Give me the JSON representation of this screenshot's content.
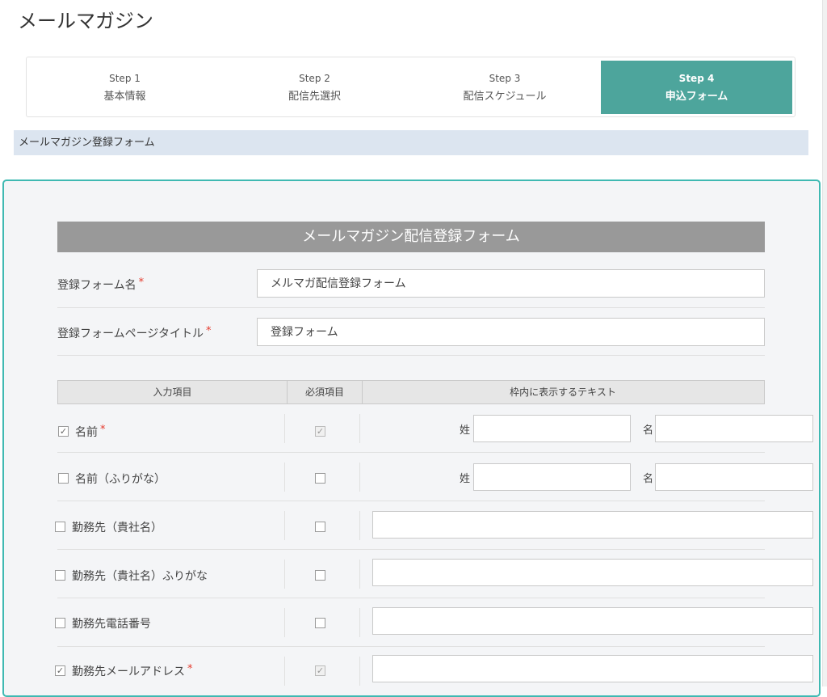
{
  "page": {
    "title": "メールマガジン"
  },
  "steps": [
    {
      "num": "Step 1",
      "label": "基本情報",
      "active": false
    },
    {
      "num": "Step 2",
      "label": "配信先選択",
      "active": false
    },
    {
      "num": "Step 3",
      "label": "配信スケジュール",
      "active": false
    },
    {
      "num": "Step 4",
      "label": "申込フォーム",
      "active": true
    }
  ],
  "section": {
    "title": "メールマガジン登録フォーム"
  },
  "form": {
    "header": "メールマガジン配信登録フォーム",
    "required_mark": "*",
    "form_name": {
      "label": "登録フォーム名",
      "value": "メルマガ配信登録フォーム"
    },
    "page_title": {
      "label": "登録フォームページタイトル",
      "value": "登録フォーム"
    }
  },
  "table": {
    "col_input": "入力項目",
    "col_required": "必須項目",
    "col_text": "枠内に表示するテキスト",
    "last_name_label": "姓",
    "first_name_label": "名",
    "rows": [
      {
        "label": "名前",
        "checked": true,
        "required_mark": true,
        "required_checked": true
      },
      {
        "label": "名前（ふりがな）",
        "checked": false,
        "required_mark": false,
        "required_checked": false
      },
      {
        "label": "勤務先（貴社名）",
        "checked": false,
        "required_mark": false,
        "required_checked": false
      },
      {
        "label": "勤務先（貴社名）ふりがな",
        "checked": false,
        "required_mark": false,
        "required_checked": false
      },
      {
        "label": "勤務先電話番号",
        "checked": false,
        "required_mark": false,
        "required_checked": false
      },
      {
        "label": "勤務先メールアドレス",
        "checked": true,
        "required_mark": true,
        "required_checked": true
      }
    ]
  },
  "colors": {
    "accent": "#4da59c",
    "panel_border": "#3fb9b2",
    "band": "#dce5f0",
    "header_gray": "#999999",
    "required": "#e5392c"
  }
}
